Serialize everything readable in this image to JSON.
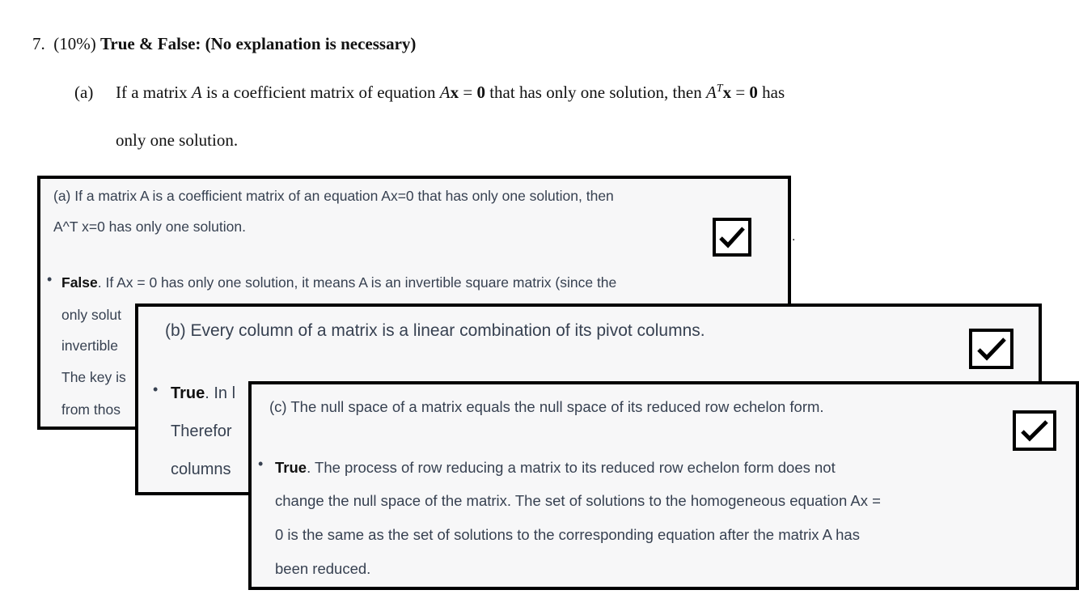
{
  "question": {
    "number": "7.",
    "weight": "(10%)",
    "title": "True & False: (No explanation is necessary)",
    "part_a": {
      "label": "(a)",
      "t1": "If a matrix ",
      "A": "A",
      "t2": " is a coefficient matrix of equation ",
      "x": "x",
      "eq": " = ",
      "zero": "0",
      "t3": " that has only one solution, then ",
      "sup": "T",
      "t4": " has",
      "line2": "only one solution."
    }
  },
  "stray_mark": ".",
  "panels": {
    "a": {
      "question_lines": [
        "(a) If a matrix A is a coefficient matrix of an equation Ax=0 that has only one solution, then",
        "A^T x=0 has only one solution."
      ],
      "bullet": "•",
      "verdict": "False",
      "answer_first_rest": ". If Ax = 0 has only one solution, it means A is an invertible square matrix (since the",
      "answer_lines": [
        "only solut",
        "invertible",
        "The key is",
        "from thos"
      ]
    },
    "b": {
      "question": "(b) Every column of a matrix is a linear combination of its pivot columns.",
      "bullet": "•",
      "verdict": "True",
      "answer_first_rest": ". In l",
      "answer_lines": [
        "Therefor",
        "columns"
      ]
    },
    "c": {
      "question": "(c) The null space of a matrix equals the null space of its reduced row echelon form.",
      "bullet": "•",
      "verdict": "True",
      "answer_first_rest": ". The process of row reducing a matrix to its reduced row echelon form does not",
      "answer_lines": [
        "change the null space of the matrix. The set of solutions to the homogeneous equation Ax =",
        "0 is the same as the set of solutions to the corresponding equation after the matrix A has",
        "been reduced."
      ]
    }
  },
  "icons": {
    "check": "checkbox-checked-icon"
  },
  "colors": {
    "panel_bg": "#f7f7f8",
    "border": "#000000",
    "text": "#374151"
  }
}
